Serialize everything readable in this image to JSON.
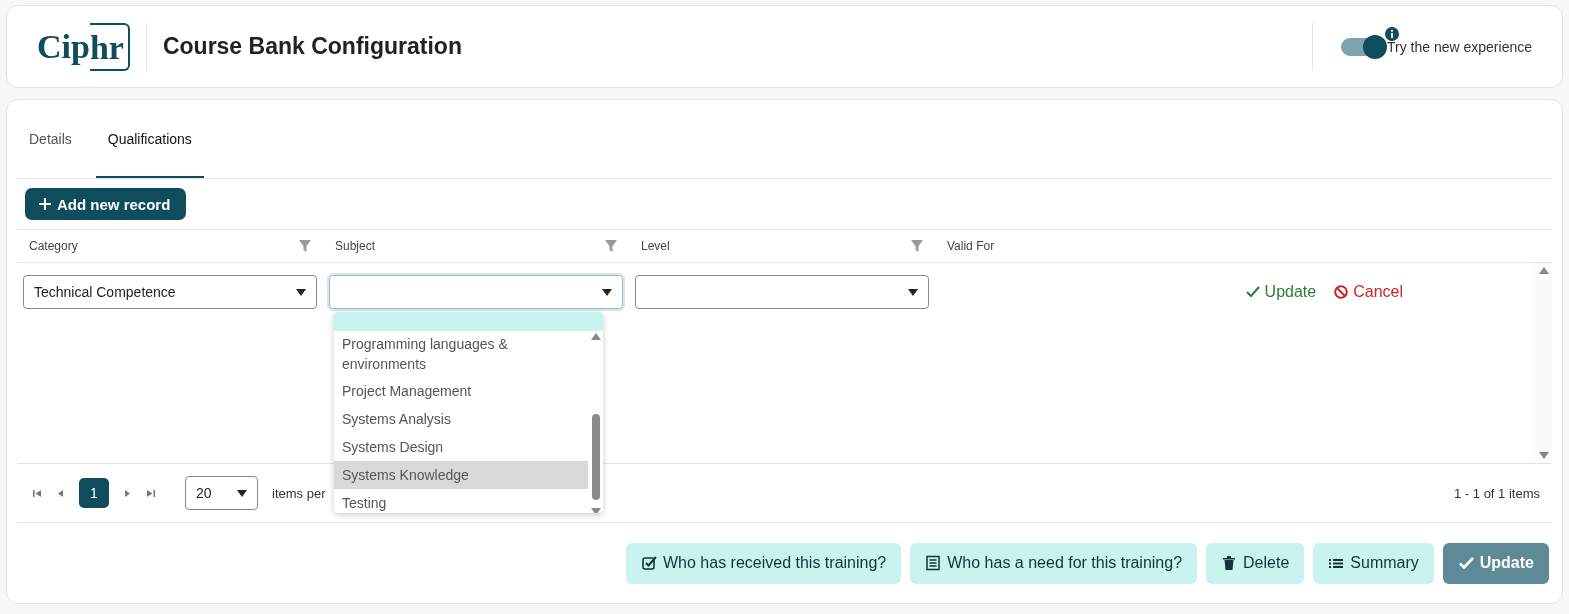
{
  "header": {
    "logo": "Ciphr",
    "title": "Course Bank Configuration",
    "toggle": {
      "label": "Try the new experience",
      "on": true
    }
  },
  "tabs": [
    {
      "label": "Details",
      "selected": false
    },
    {
      "label": "Qualifications",
      "selected": true
    }
  ],
  "add_button": "Add new record",
  "table": {
    "columns": [
      {
        "label": "Category",
        "filter": true
      },
      {
        "label": "Subject",
        "filter": true
      },
      {
        "label": "Level",
        "filter": true
      },
      {
        "label": "Valid For",
        "filter": false
      }
    ],
    "edit_row": {
      "fields": [
        {
          "value": "Technical Competence",
          "focused": false
        },
        {
          "focused": true
        },
        {
          "focused": false
        }
      ],
      "update": "Update",
      "cancel": "Cancel"
    },
    "dropdown": {
      "options": [
        {
          "label": "Programming languages & environments",
          "selected": false
        },
        {
          "label": "Project Management",
          "selected": false
        },
        {
          "label": "Systems Analysis",
          "selected": false
        },
        {
          "label": "Systems Design",
          "selected": false
        },
        {
          "label": "Systems Knowledge",
          "selected": true
        },
        {
          "label": "Testing",
          "selected": false
        }
      ]
    }
  },
  "pager": {
    "pages": [
      {
        "label": "1",
        "selected": true
      }
    ],
    "page_size": "20",
    "page_size_label": "items per",
    "summary": "1 - 1 of 1 items"
  },
  "actions": [
    {
      "label": "Who has received this training?",
      "kind": "received",
      "primary": false
    },
    {
      "label": "Who has a need for this training?",
      "kind": "need",
      "primary": false
    },
    {
      "label": "Delete",
      "kind": "delete",
      "primary": false
    },
    {
      "label": "Summary",
      "kind": "summary",
      "primary": false
    },
    {
      "label": "Update",
      "kind": "update",
      "primary": true
    }
  ]
}
